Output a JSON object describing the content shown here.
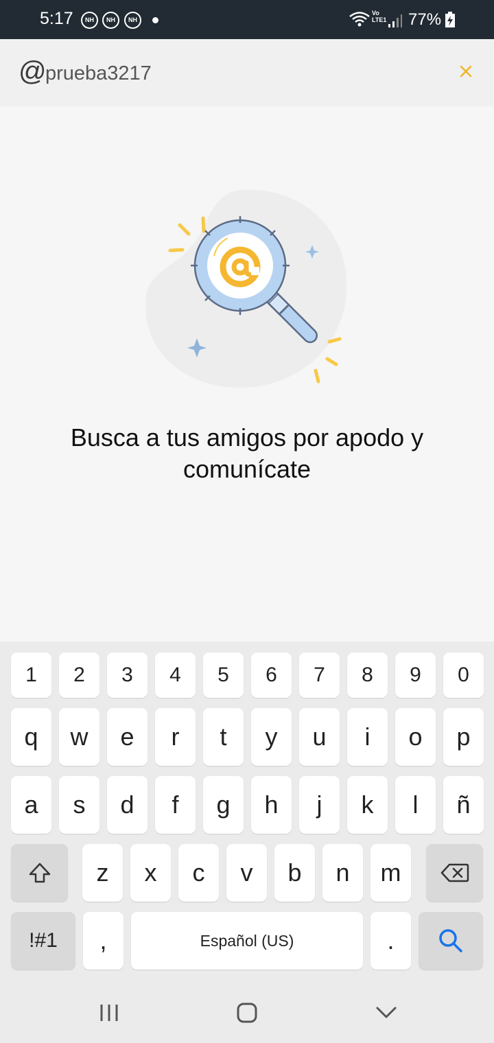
{
  "status_bar": {
    "time": "5:17",
    "notification_icons": [
      "NH",
      "NH",
      "NH"
    ],
    "volte_line1": "Vo",
    "volte_line2": "LTE1",
    "battery": "77%"
  },
  "search": {
    "at_symbol": "@",
    "value": "prueba3217",
    "placeholder": ""
  },
  "empty_state": {
    "message": "Busca a tus amigos por apodo y comunícate"
  },
  "keyboard": {
    "row_numbers": [
      "1",
      "2",
      "3",
      "4",
      "5",
      "6",
      "7",
      "8",
      "9",
      "0"
    ],
    "row_1": [
      "q",
      "w",
      "e",
      "r",
      "t",
      "y",
      "u",
      "i",
      "o",
      "p"
    ],
    "row_2": [
      "a",
      "s",
      "d",
      "f",
      "g",
      "h",
      "j",
      "k",
      "l",
      "ñ"
    ],
    "row_3": [
      "z",
      "x",
      "c",
      "v",
      "b",
      "n",
      "m"
    ],
    "symbols_label": "!#1",
    "comma": ",",
    "space_label": "Español (US)",
    "period": ".",
    "accent_color": "#1a73e8"
  },
  "colors": {
    "status_bar_bg": "#222b33",
    "close_icon": "#f0b429",
    "illustration_accent": "#f5b731"
  }
}
